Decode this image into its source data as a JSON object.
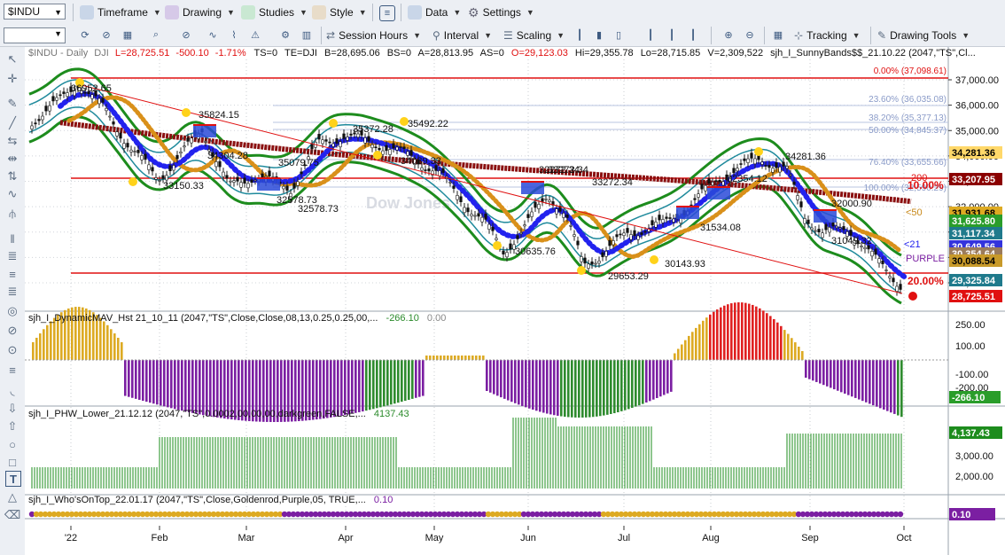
{
  "toolbar1": {
    "symbol": "$INDU",
    "menus": [
      "Timeframe",
      "Drawing",
      "Studies",
      "Style",
      "Data",
      "Settings"
    ]
  },
  "toolbar2": {
    "session_hours": "Session Hours",
    "interval": "Interval",
    "scaling": "Scaling",
    "tracking": "Tracking",
    "drawing_tools": "Drawing Tools"
  },
  "price_header": {
    "symbol": "$INDU - Daily",
    "exchange": "DJI",
    "last": "L=28,725.51",
    "change": "-500.10",
    "change_pct": "-1.71%",
    "ts": "TS=0",
    "te": "TE=DJI",
    "bid": "B=28,695.06",
    "bs": "BS=0",
    "ask": "A=28,813.95",
    "as": "AS=0",
    "open": "O=29,123.03",
    "high": "Hi=29,355.78",
    "low": "Lo=28,715.85",
    "volume": "V=2,309,522",
    "study": "sjh_I_SunnyBands$$_21.10.22 (2047,\"TS\",Cl..."
  },
  "price_axis": {
    "ticks": [
      "37,000.00",
      "36,000.00",
      "35,000.00",
      "34,000.00",
      "33,000.00",
      "32,000.00",
      "31,000.00",
      "30,000.00",
      "29,000.00"
    ],
    "badges": [
      {
        "text": "34,281.36",
        "bg": "#ffd86a",
        "fg": "#000000"
      },
      {
        "text": "33,207.95",
        "bg": "#8b0000",
        "fg": "#ffffff"
      },
      {
        "text": "31,931.68",
        "bg": "#ddaa22",
        "fg": "#000000"
      },
      {
        "text": "31,625.80",
        "bg": "#2a9d2a",
        "fg": "#ffffff"
      },
      {
        "text": "31,117.34",
        "bg": "#1f7a8c",
        "fg": "#ffffff"
      },
      {
        "text": "30,649.56",
        "bg": "#3333dd",
        "fg": "#ffffff"
      },
      {
        "text": "30,354.64",
        "bg": "#9b7b5b",
        "fg": "#ffffff"
      },
      {
        "text": "30,088.54",
        "bg": "#c89a2a",
        "fg": "#000000"
      },
      {
        "text": "29,325.84",
        "bg": "#1f7a8c",
        "fg": "#ffffff"
      },
      {
        "text": "28,725.51",
        "bg": "#e01010",
        "fg": "#ffffff"
      }
    ]
  },
  "price_annotations": [
    "36952.65",
    "35824.15",
    "35372.28",
    "35492.22",
    "34304.28",
    "33150.33",
    "35079.75",
    "32578.73",
    "32578.73",
    "34039.33",
    "33272.34",
    "30635.76",
    "29653.29",
    "31534.08",
    "30143.93",
    "34281.36",
    "32354.12",
    "32000.90",
    "31049.32",
    "32272.34",
    "33272.34"
  ],
  "fib_labels": [
    "0.00% (37,098.61)",
    "23.60% (36,035.08)",
    "38.20% (35,377.13)",
    "50.00% (34,845.37)",
    "76.40% (33,655.66)",
    "100.00% (32,590.29)"
  ],
  "line_labels": {
    "ten_pct": "10.00%",
    "twenty_pct": "20.00%",
    "ma200": "200",
    "ma50": "<50",
    "ma21": "<21",
    "purple": "PURPLE"
  },
  "watermark": "Dow Jones",
  "pane1": {
    "title": "sjh_I_DynamicMAV_Hst 21_10_11 (2047,\"TS\",Close,Close,08,13,0.25,0.25,00,...",
    "value1": "-266.10",
    "value2": "0.00",
    "ticks": [
      "250.00",
      "100.00",
      "-100.00",
      "-200.00"
    ],
    "badge": "-266.10"
  },
  "pane2": {
    "title": "sjh_I_PHW_Lower_21.12.12 (2047,\"TS\",0.0002,00,00,00,darkgreen,FALSE,...",
    "value": "4137.43",
    "ticks": [
      "3,000.00",
      "2,000.00"
    ],
    "badge": "4,137.43"
  },
  "pane3": {
    "title": "sjh_I_Who'sOnTop_22.01.17 (2047,\"TS\",Close,Goldenrod,Purple,05, TRUE,...",
    "value": "0.10",
    "badge": "0.10"
  },
  "x_axis": {
    "labels": [
      "'22",
      "Feb",
      "Mar",
      "Apr",
      "May",
      "Jun",
      "Jul",
      "Aug",
      "Sep",
      "Oct"
    ]
  },
  "colors": {
    "green_band": "#1d8c1d",
    "teal_band": "#1f8a9c",
    "blue_dots": "#2222ee",
    "orange_dots": "#d9901a",
    "maroon_ma": "#8b1010",
    "purple": "#7b1fa2",
    "gold": "#ddaa22",
    "red": "#e01010",
    "hist_red": "#e02020"
  }
}
